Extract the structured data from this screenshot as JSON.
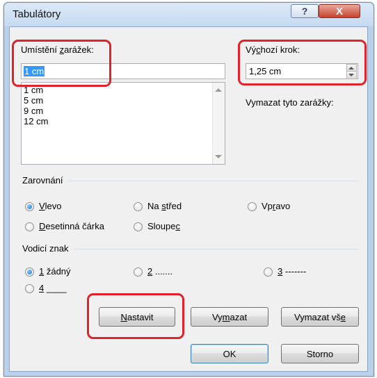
{
  "window": {
    "title": "Tabulátory",
    "help_label": "?",
    "close_label": "X"
  },
  "positions": {
    "label_pre": "Umístění ",
    "label_key": "z",
    "label_post": "arážek:",
    "value": "1 cm",
    "list": [
      "1 cm",
      "5 cm",
      "9 cm",
      "12 cm"
    ]
  },
  "default_step": {
    "label_pre": "Vý",
    "label_key": "c",
    "label_post": "hozí krok:",
    "value": "1,25 cm"
  },
  "clear_label": "Vymazat tyto zarážky:",
  "alignment": {
    "title": "Zarovnání",
    "options": [
      {
        "pre": "",
        "key": "V",
        "post": "levo",
        "checked": true
      },
      {
        "pre": "Na ",
        "key": "s",
        "post": "třed",
        "checked": false
      },
      {
        "pre": "Vp",
        "key": "r",
        "post": "avo",
        "checked": false
      },
      {
        "pre": "",
        "key": "D",
        "post": "esetinná čárka",
        "checked": false
      },
      {
        "pre": "Sloupe",
        "key": "c",
        "post": "",
        "checked": false
      }
    ]
  },
  "leader": {
    "title": "Vodicí znak",
    "options": [
      {
        "key": "1",
        "post": " žádný",
        "checked": true
      },
      {
        "key": "2",
        "post": " .......",
        "checked": false
      },
      {
        "key": "3",
        "post": " -------",
        "checked": false
      },
      {
        "key": "4",
        "post": " ____",
        "checked": false
      }
    ]
  },
  "buttons": {
    "set": {
      "pre": "",
      "key": "N",
      "post": "astavit"
    },
    "clear": {
      "pre": "Vy",
      "key": "m",
      "post": "azat"
    },
    "clear_all": {
      "pre": "Vymazat vš",
      "key": "e",
      "post": ""
    },
    "ok": "OK",
    "cancel": "Storno"
  },
  "colors": {
    "highlight": "#e0232b",
    "selection": "#3399ff"
  }
}
